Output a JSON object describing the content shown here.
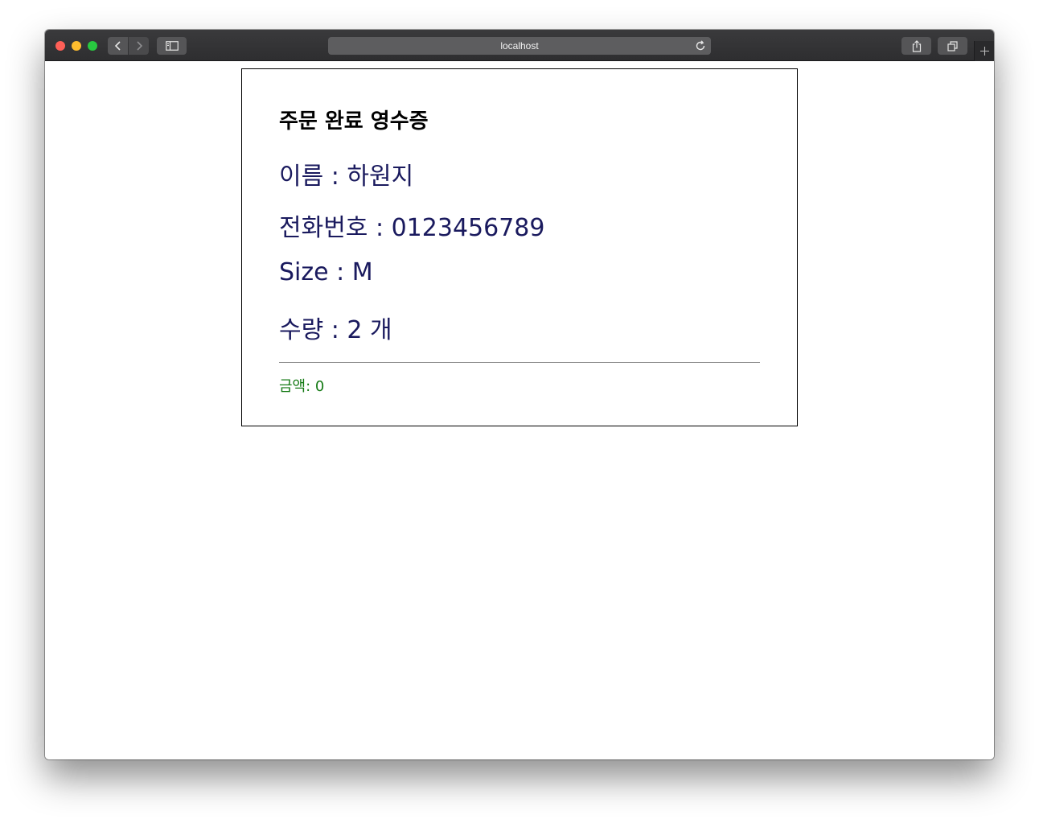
{
  "browser": {
    "url": "localhost"
  },
  "receipt": {
    "title": "주문 완료 영수증",
    "name_label": "이름",
    "name_value": "하원지",
    "phone_label": "전화번호",
    "phone_value": "0123456789",
    "size_label": "Size",
    "size_value": "M",
    "qty_label": "수량",
    "qty_value": "2",
    "qty_unit": "개",
    "amount_label": "금액",
    "amount_value": "0"
  }
}
